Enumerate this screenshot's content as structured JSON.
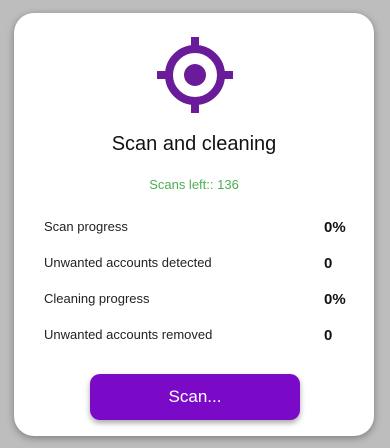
{
  "card": {
    "icon": "crosshair-target-icon",
    "title": "Scan and cleaning",
    "scans_left": "Scans left:: 136"
  },
  "stats": [
    {
      "label": "Scan progress",
      "value": "0%"
    },
    {
      "label": "Unwanted accounts detected",
      "value": "0"
    },
    {
      "label": "Cleaning progress",
      "value": "0%"
    },
    {
      "label": "Unwanted accounts removed",
      "value": "0"
    }
  ],
  "actions": {
    "scan_label": "Scan..."
  },
  "colors": {
    "accent": "#6a1b9a",
    "button": "#7b0ac8",
    "scans_left_text": "#4caf50"
  }
}
